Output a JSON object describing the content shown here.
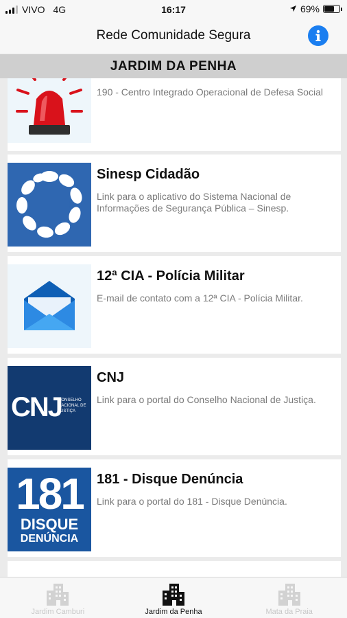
{
  "status_bar": {
    "carrier": "VIVO",
    "network": "4G",
    "time": "16:17",
    "battery": "69%",
    "battery_level": 0.69
  },
  "header": {
    "title": "Rede Comunidade Segura",
    "info_icon": "info-icon",
    "accent_color": "#1a7ef0"
  },
  "section": {
    "title": "JARDIM DA PENHA"
  },
  "items": [
    {
      "title": "",
      "description": "190 - Centro Integrado Operacional de Defesa Social",
      "icon": "siren-icon"
    },
    {
      "title": "Sinesp Cidadão",
      "description": "Link para o aplicativo do Sistema Nacional de Informações de Segurança Pública – Sinesp.",
      "icon": "sinesp-logo"
    },
    {
      "title": "12ª CIA - Polícia Militar",
      "description": "E-mail de contato com a 12ª CIA - Polícia Militar.",
      "icon": "mail-icon"
    },
    {
      "title": "CNJ",
      "description": "Link para o portal do Conselho Nacional de Justiça.",
      "icon": "cnj-logo",
      "logo_text": "CNJ",
      "logo_subtext": "CONSELHO NACIONAL DE JUSTIÇA"
    },
    {
      "title": "181 - Disque Denúncia",
      "description": "Link para o portal do 181 - Disque Denúncia.",
      "icon": "disque-denuncia-logo",
      "logo_number": "181",
      "logo_line1": "DISQUE",
      "logo_line2": "DENÚNCIA"
    }
  ],
  "tabs": [
    {
      "label": "Jardim Camburi",
      "icon": "buildings-icon",
      "active": false
    },
    {
      "label": "Jardim da Penha",
      "icon": "buildings-icon",
      "active": true
    },
    {
      "label": "Mata da Praia",
      "icon": "buildings-icon",
      "active": false
    }
  ]
}
